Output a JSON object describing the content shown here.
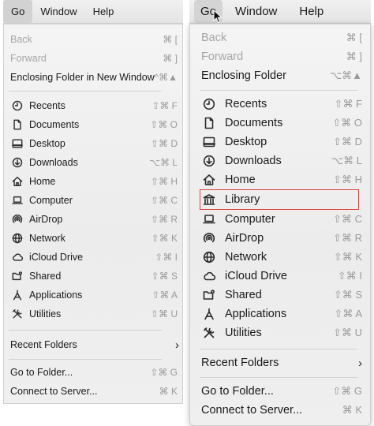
{
  "left": {
    "menubar": {
      "go": "Go",
      "window": "Window",
      "help": "Help"
    },
    "items": [
      {
        "label": "Back",
        "shortcut": "⌘ [",
        "disabled": true
      },
      {
        "label": "Forward",
        "shortcut": "⌘ ]",
        "disabled": true
      },
      {
        "label": "Enclosing Folder in New Window",
        "shortcut": "^⌘▲"
      },
      {
        "label": "Recents",
        "icon": "clock-icon",
        "shortcut": "⇧⌘ F"
      },
      {
        "label": "Documents",
        "icon": "document-icon",
        "shortcut": "⇧⌘ O"
      },
      {
        "label": "Desktop",
        "icon": "desktop-icon",
        "shortcut": "⇧⌘ D"
      },
      {
        "label": "Downloads",
        "icon": "download-icon",
        "shortcut": "⌥⌘ L"
      },
      {
        "label": "Home",
        "icon": "home-icon",
        "shortcut": "⇧⌘ H"
      },
      {
        "label": "Computer",
        "icon": "laptop-icon",
        "shortcut": "⇧⌘ C"
      },
      {
        "label": "AirDrop",
        "icon": "airdrop-icon",
        "shortcut": "⇧⌘ R"
      },
      {
        "label": "Network",
        "icon": "globe-icon",
        "shortcut": "⇧⌘ K"
      },
      {
        "label": "iCloud Drive",
        "icon": "cloud-icon",
        "shortcut": "⇧⌘ I"
      },
      {
        "label": "Shared",
        "icon": "shared-folder-icon",
        "shortcut": "⇧⌘ S"
      },
      {
        "label": "Applications",
        "icon": "applications-icon",
        "shortcut": "⇧⌘ A"
      },
      {
        "label": "Utilities",
        "icon": "tools-icon",
        "shortcut": "⇧⌘ U"
      },
      {
        "label": "Recent Folders"
      },
      {
        "label": "Go to Folder...",
        "shortcut": "⇧⌘ G"
      },
      {
        "label": "Connect to Server...",
        "shortcut": "⌘ K"
      }
    ]
  },
  "right": {
    "menubar": {
      "go": "Go",
      "window": "Window",
      "help": "Help"
    },
    "items": [
      {
        "label": "Back",
        "shortcut": "⌘ [",
        "disabled": true
      },
      {
        "label": "Forward",
        "shortcut": "⌘ ]",
        "disabled": true
      },
      {
        "label": "Enclosing Folder",
        "shortcut": "⌥⌘▲"
      },
      {
        "label": "Recents",
        "icon": "clock-icon",
        "shortcut": "⇧⌘ F"
      },
      {
        "label": "Documents",
        "icon": "document-icon",
        "shortcut": "⇧⌘ O"
      },
      {
        "label": "Desktop",
        "icon": "desktop-icon",
        "shortcut": "⇧⌘ D"
      },
      {
        "label": "Downloads",
        "icon": "download-icon",
        "shortcut": "⌥⌘ L"
      },
      {
        "label": "Home",
        "icon": "home-icon",
        "shortcut": "⇧⌘ H"
      },
      {
        "label": "Library",
        "icon": "library-icon",
        "highlighted": true
      },
      {
        "label": "Computer",
        "icon": "laptop-icon",
        "shortcut": "⇧⌘ C"
      },
      {
        "label": "AirDrop",
        "icon": "airdrop-icon",
        "shortcut": "⇧⌘ R"
      },
      {
        "label": "Network",
        "icon": "globe-icon",
        "shortcut": "⇧⌘ K"
      },
      {
        "label": "iCloud Drive",
        "icon": "cloud-icon",
        "shortcut": "⇧⌘ I"
      },
      {
        "label": "Shared",
        "icon": "shared-folder-icon",
        "shortcut": "⇧⌘ S"
      },
      {
        "label": "Applications",
        "icon": "applications-icon",
        "shortcut": "⇧⌘ A"
      },
      {
        "label": "Utilities",
        "icon": "tools-icon",
        "shortcut": "⇧⌘ U"
      },
      {
        "label": "Recent Folders"
      },
      {
        "label": "Go to Folder...",
        "shortcut": "⇧⌘ G"
      },
      {
        "label": "Connect to Server...",
        "shortcut": "⌘ K"
      }
    ]
  },
  "colors": {
    "highlight_border": "#d9473a",
    "disabled_text": "#a6a6a6",
    "shortcut_text": "#9a9a9a"
  },
  "submenu_indicator": "›"
}
